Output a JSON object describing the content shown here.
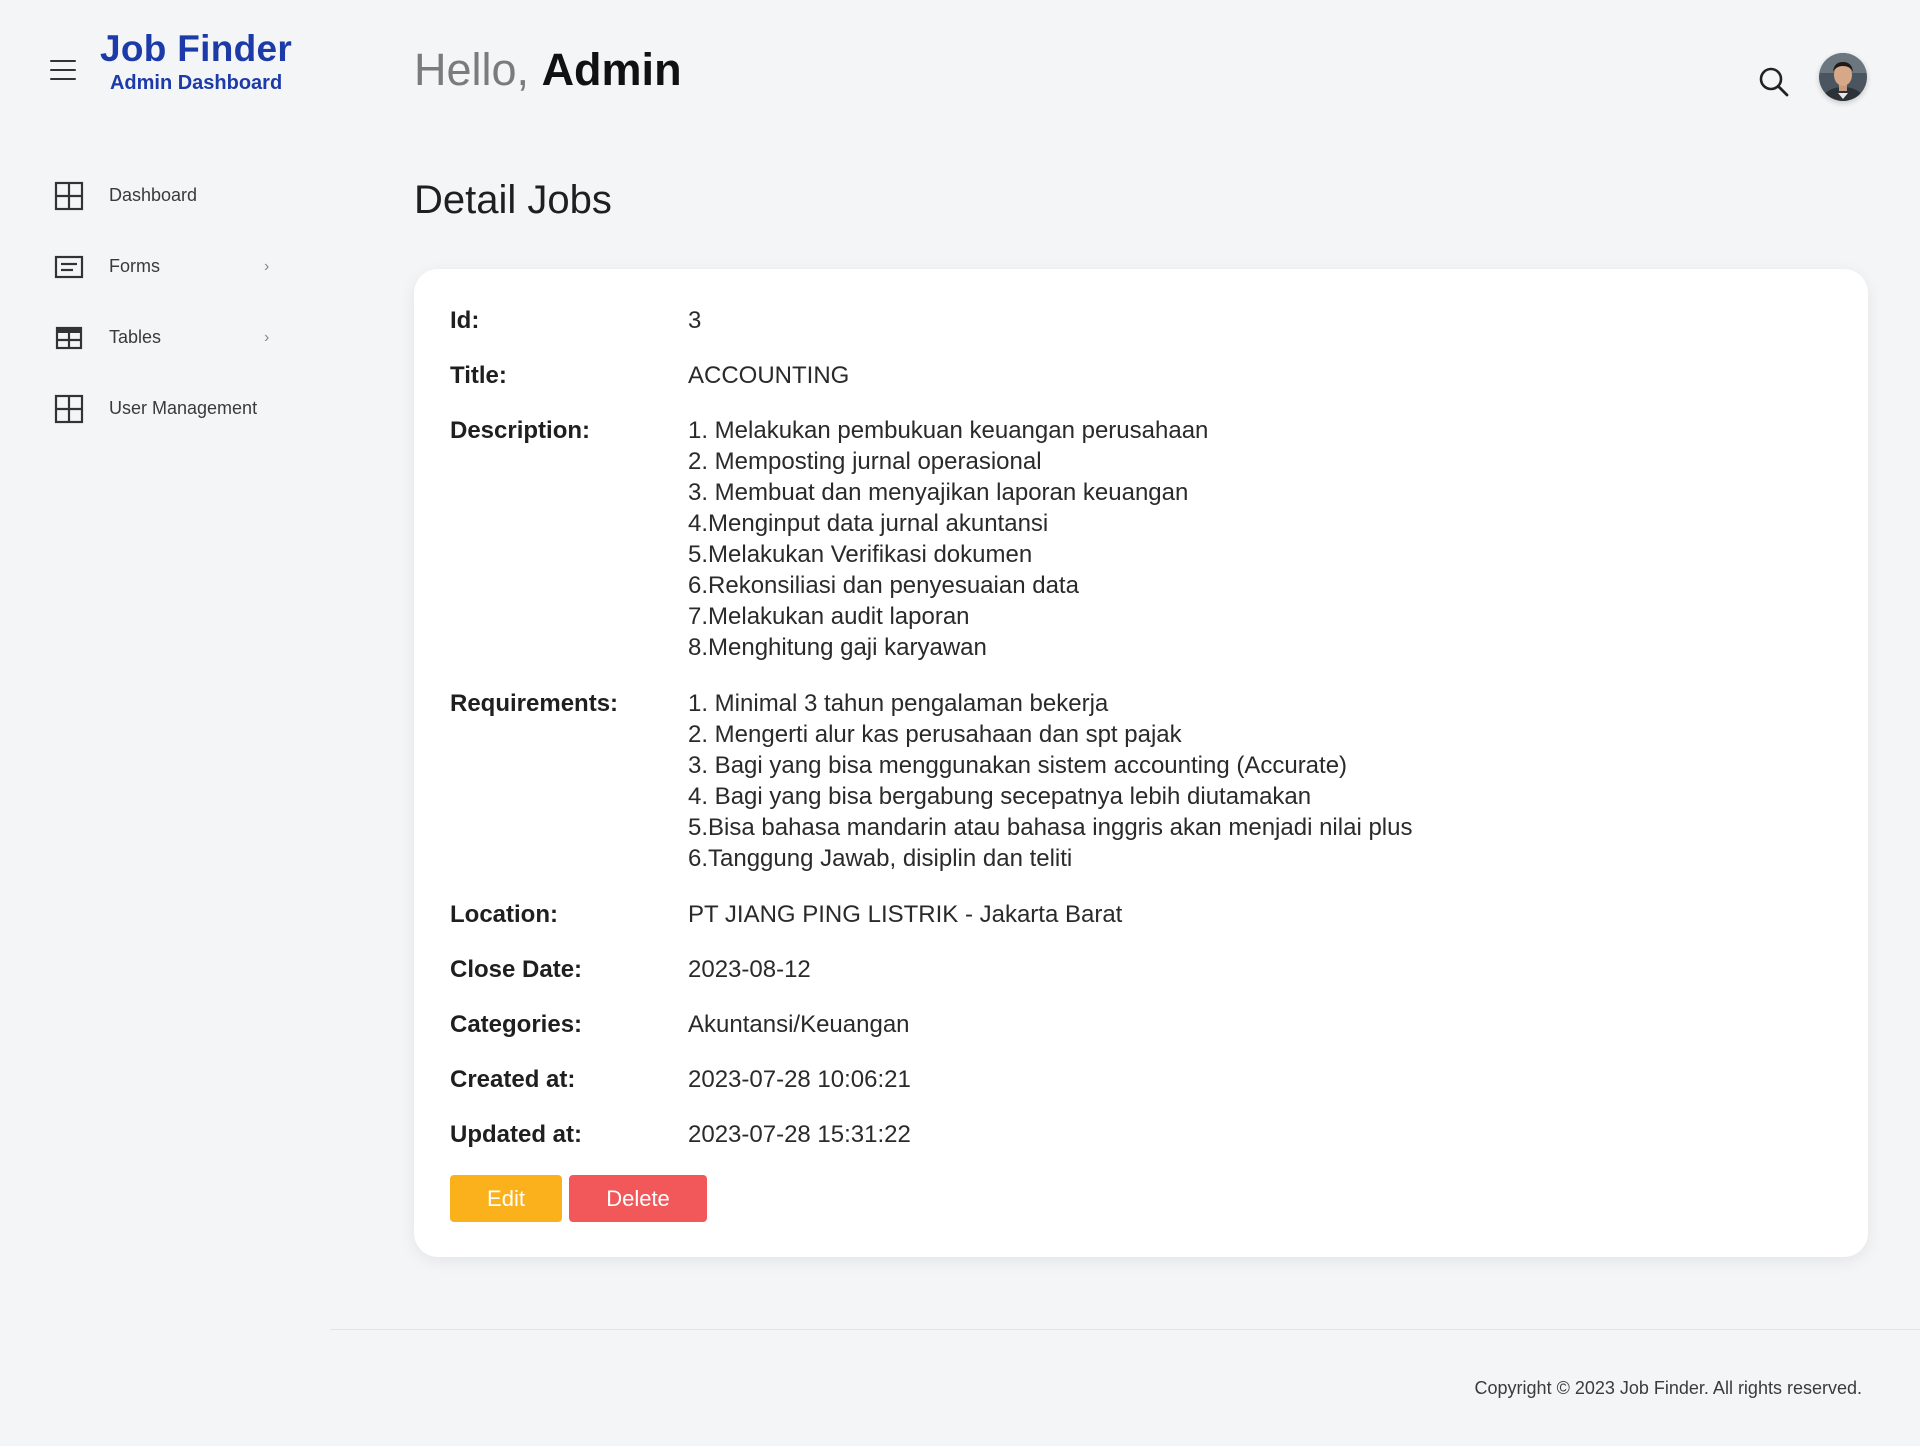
{
  "brand": {
    "title": "Job Finder",
    "subtitle": "Admin Dashboard",
    "color": "#1c3ba9"
  },
  "sidebar": {
    "items": [
      {
        "label": "Dashboard",
        "icon": "grid-icon",
        "has_submenu": false
      },
      {
        "label": "Forms",
        "icon": "form-icon",
        "has_submenu": true
      },
      {
        "label": "Tables",
        "icon": "table-icon",
        "has_submenu": true
      },
      {
        "label": "User Management",
        "icon": "grid-icon",
        "has_submenu": false
      }
    ],
    "chevron": "›"
  },
  "header": {
    "hello": "Hello, ",
    "name": "Admin",
    "search_icon": "search-icon",
    "avatar_icon": "user-avatar"
  },
  "page": {
    "title": "Detail Jobs"
  },
  "job": {
    "id_label": "Id:",
    "id": "3",
    "title_label": "Title:",
    "title": "ACCOUNTING",
    "description_label": "Description:",
    "description": [
      "1. Melakukan pembukuan keuangan perusahaan",
      "2. Memposting jurnal operasional",
      "3. Membuat dan menyajikan laporan keuangan",
      "4.Menginput data jurnal akuntansi",
      "5.Melakukan Verifikasi dokumen",
      "6.Rekonsiliasi dan penyesuaian data",
      "7.Melakukan audit laporan",
      "8.Menghitung gaji karyawan"
    ],
    "requirements_label": "Requirements:",
    "requirements": [
      "1. Minimal 3 tahun pengalaman bekerja",
      "2. Mengerti alur kas perusahaan dan spt pajak",
      "3. Bagi yang bisa menggunakan sistem accounting (Accurate)",
      "4. Bagi yang bisa bergabung secepatnya lebih diutamakan",
      "5.Bisa bahasa mandarin atau bahasa inggris akan menjadi nilai plus",
      "6.Tanggung Jawab, disiplin dan teliti"
    ],
    "location_label": "Location:",
    "location": "PT JIANG PING LISTRIK - Jakarta Barat",
    "close_date_label": "Close Date:",
    "close_date": "2023-08-12",
    "categories_label": "Categories:",
    "categories": "Akuntansi/Keuangan",
    "created_at_label": "Created at:",
    "created_at": "2023-07-28 10:06:21",
    "updated_at_label": "Updated at:",
    "updated_at": "2023-07-28 15:31:22"
  },
  "actions": {
    "edit_label": "Edit",
    "delete_label": "Delete",
    "edit_color": "#fbb11b",
    "delete_color": "#f2585a"
  },
  "footer": {
    "copyright": "Copyright © 2023 Job Finder. All rights reserved."
  }
}
